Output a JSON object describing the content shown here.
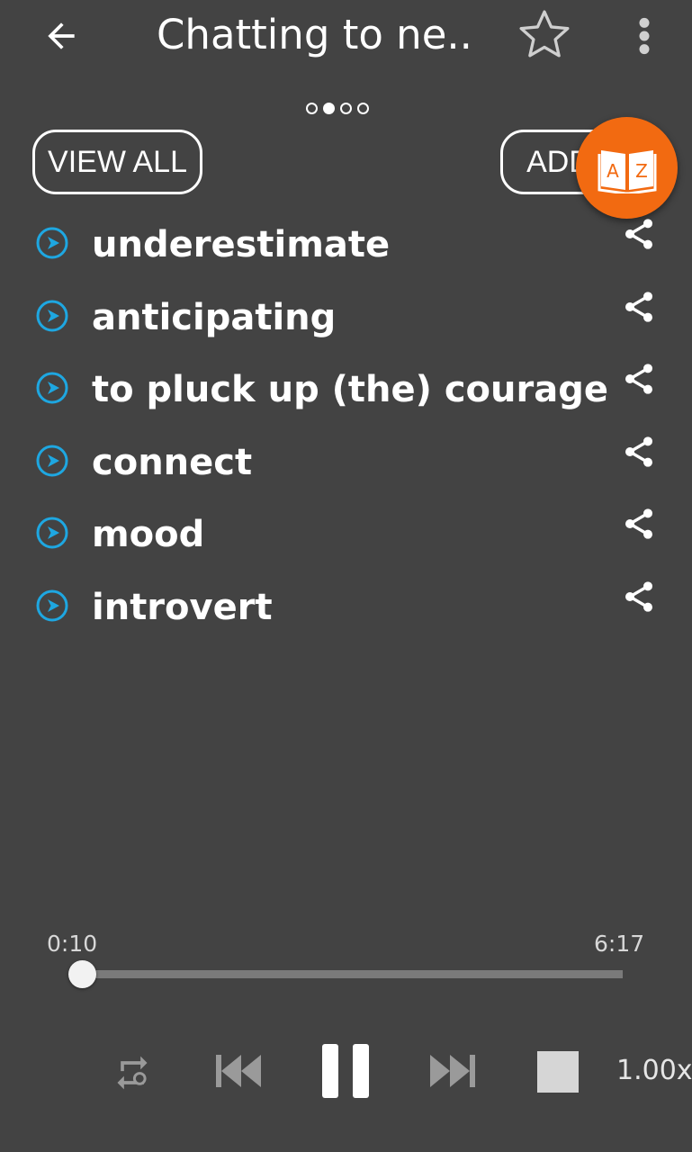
{
  "appbar": {
    "title": "Chatting to ne..",
    "icons": {
      "back": "arrow-left-icon",
      "favorite": "star-outline-icon",
      "more": "more-vert-icon"
    }
  },
  "pager": {
    "count": 4,
    "active_index": 1
  },
  "buttons": {
    "view_all": "VIEW ALL",
    "add": "ADD"
  },
  "fab": {
    "icon": "dictionary-book-az-icon",
    "letter_a": "A",
    "letter_z": "Z"
  },
  "words": [
    {
      "text": "underestimate"
    },
    {
      "text": "anticipating"
    },
    {
      "text": "to pluck up (the) courage"
    },
    {
      "text": "connect"
    },
    {
      "text": "mood"
    },
    {
      "text": "introvert"
    }
  ],
  "player": {
    "current_time": "0:10",
    "total_time": "6:17",
    "speed": "1.00x",
    "icons": [
      "repeat-icon",
      "skip-previous-icon",
      "pause-icon",
      "skip-next-icon",
      "stop-icon"
    ]
  },
  "colors": {
    "background": "#434343",
    "accent": "#1ea7e1",
    "fab": "#f26a11"
  }
}
